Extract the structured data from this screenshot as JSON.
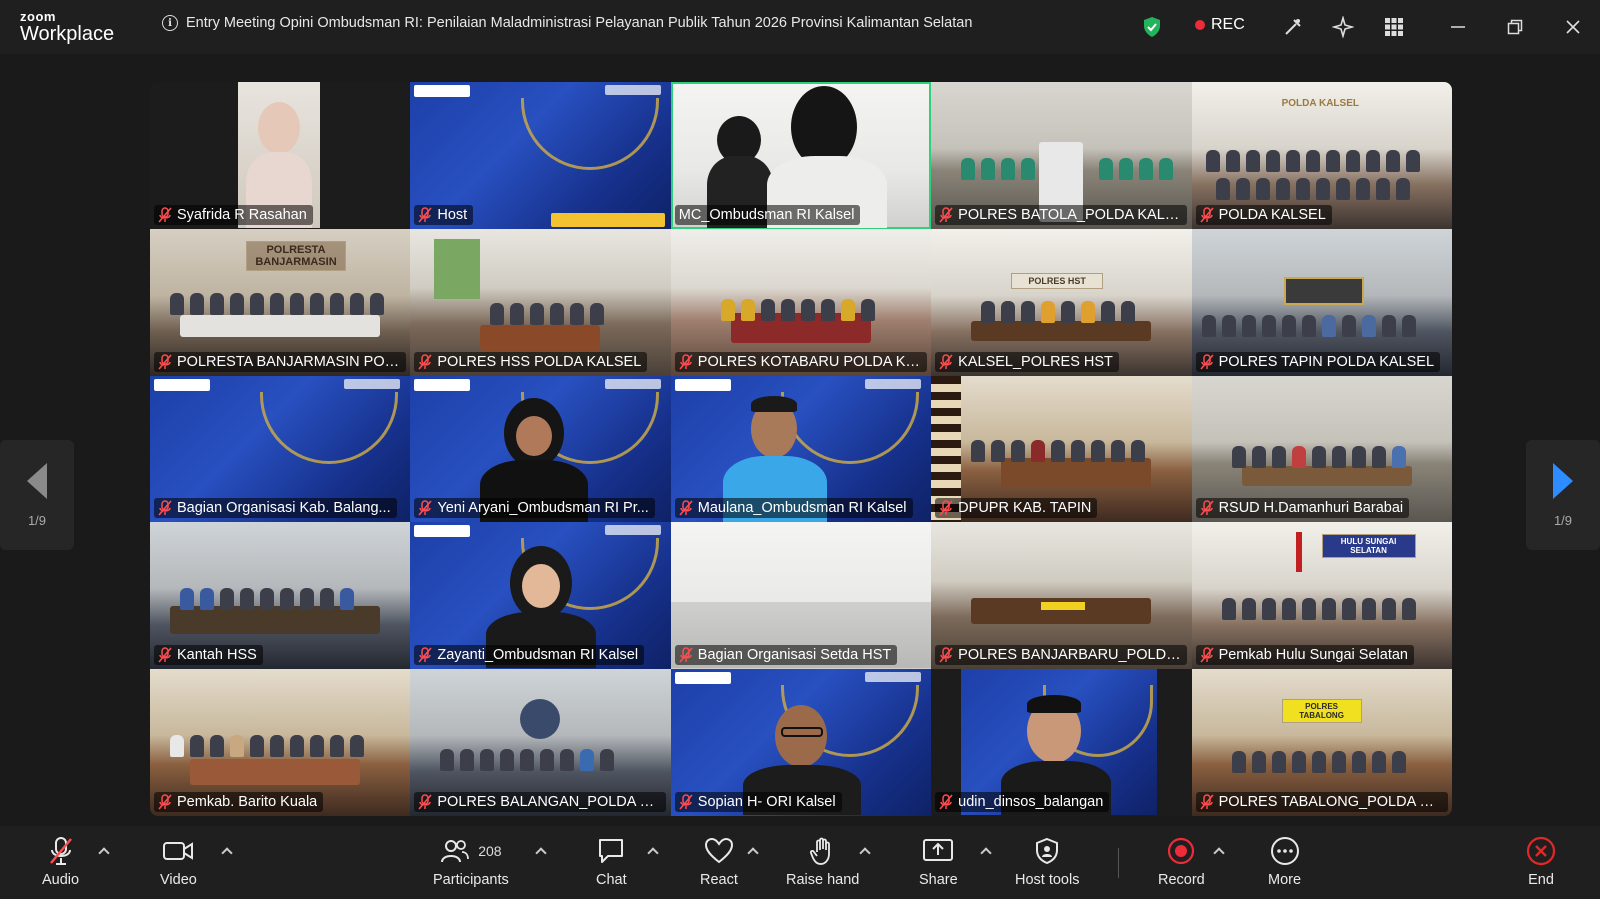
{
  "app": {
    "brand_top": "zoom",
    "brand_bottom": "Workplace"
  },
  "meeting": {
    "title": "Entry Meeting Opini Ombudsman RI: Penilaian Maladministrasi Pelayanan Publik Tahun 2026 Provinsi Kalimantan Selatan"
  },
  "status": {
    "rec_label": "REC"
  },
  "pager": {
    "left": "1/9",
    "right": "1/9"
  },
  "tiles": [
    {
      "name": "Syafrida R Rasahan"
    },
    {
      "name": "Host"
    },
    {
      "name": "MC_Ombudsman RI Kalsel"
    },
    {
      "name": "POLRES BATOLA_POLDA KALSEL"
    },
    {
      "name": "POLDA KALSEL"
    },
    {
      "name": "POLRESTA BANJARMASIN POL..."
    },
    {
      "name": "POLRES HSS POLDA KALSEL"
    },
    {
      "name": "POLRES KOTABARU POLDA KAL..."
    },
    {
      "name": "KALSEL_POLRES HST"
    },
    {
      "name": "POLRES TAPIN POLDA KALSEL"
    },
    {
      "name": "Bagian Organisasi Kab. Balang..."
    },
    {
      "name": "Yeni Aryani_Ombudsman RI Pr..."
    },
    {
      "name": "Maulana_Ombudsman RI Kalsel"
    },
    {
      "name": "DPUPR KAB. TAPIN"
    },
    {
      "name": "RSUD H.Damanhuri Barabai"
    },
    {
      "name": "Kantah HSS"
    },
    {
      "name": "Zayanti_Ombudsman RI Kalsel"
    },
    {
      "name": "Bagian Organisasi Setda HST"
    },
    {
      "name": "POLRES BANJARBARU_POLDA ..."
    },
    {
      "name": "Pemkab Hulu Sungai Selatan"
    },
    {
      "name": "Pemkab. Barito Kuala"
    },
    {
      "name": "POLRES BALANGAN_POLDA KA..."
    },
    {
      "name": "Sopian H- ORI Kalsel"
    },
    {
      "name": "udin_dinsos_balangan"
    },
    {
      "name": "POLRES TABALONG_POLDA KA..."
    }
  ],
  "room_signs": {
    "polresta": "POLRESTA BANJARMASIN",
    "hst": "POLRES HST",
    "polda": "POLDA KALSEL",
    "hss_selatan": "HULU SUNGAI SELATAN",
    "tabalong": "POLRES TABALONG"
  },
  "toolbar": {
    "audio": "Audio",
    "video": "Video",
    "participants": "Participants",
    "participants_count": "208",
    "chat": "Chat",
    "react": "React",
    "raise_hand": "Raise hand",
    "share": "Share",
    "host_tools": "Host tools",
    "record": "Record",
    "more": "More",
    "end": "End"
  },
  "colors": {
    "accent": "#2d8cff",
    "active_speaker": "#2fd07a",
    "rec": "#ee2b3a",
    "end": "#e02828",
    "banner": "#1d3fa8"
  }
}
